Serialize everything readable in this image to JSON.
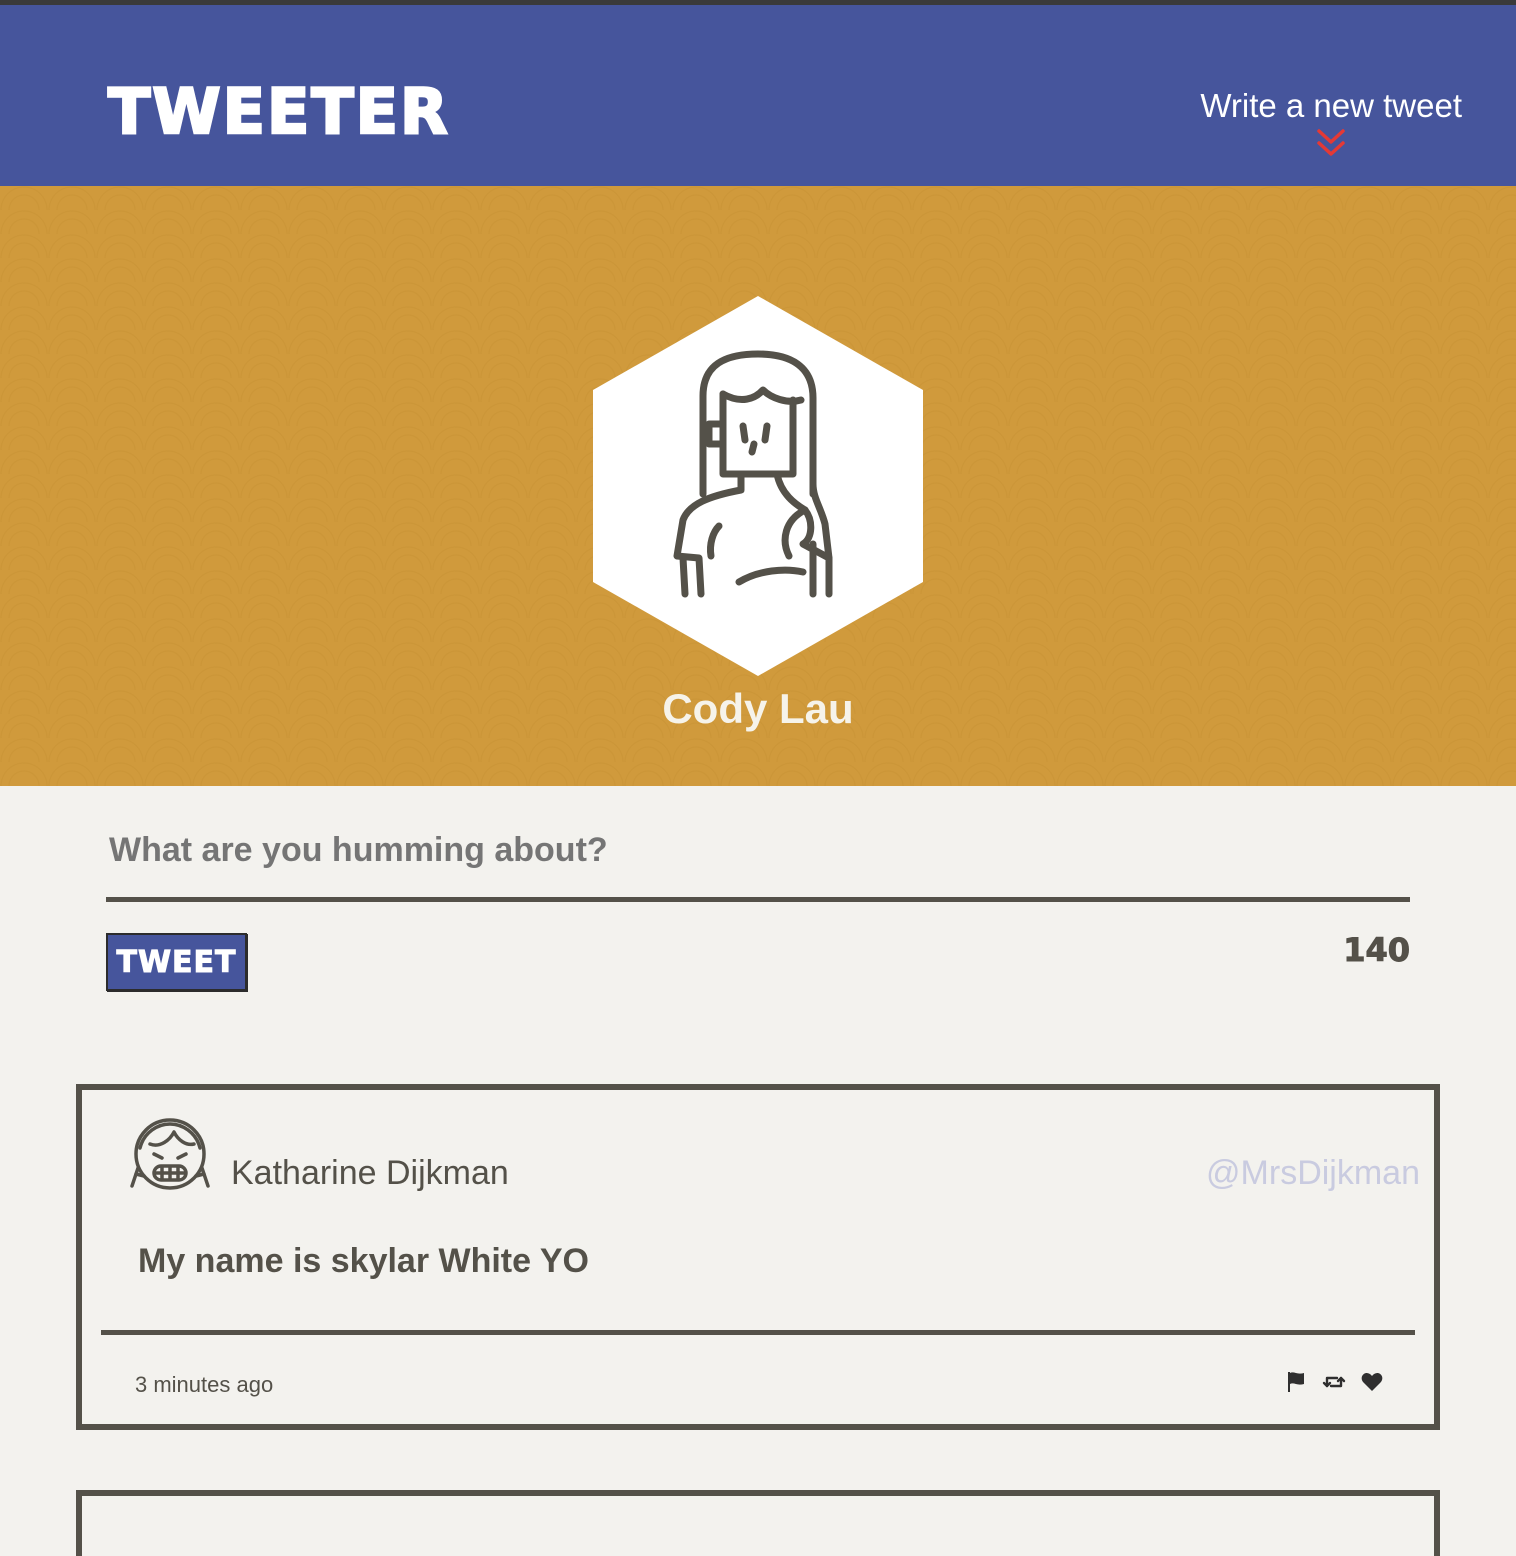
{
  "app": {
    "brand": "TWEETER",
    "nav_compose_label": "Write a new tweet"
  },
  "profile": {
    "name": "Cody Lau"
  },
  "composer": {
    "placeholder": "What are you humming about?",
    "button_label": "TWEET",
    "char_counter": "140"
  },
  "tweets": [
    {
      "author_name": "Katharine Dijkman",
      "handle": "@MrsDijkman",
      "text": "My name is skylar White YO",
      "time_ago": "3 minutes ago",
      "actions": [
        "flag-icon",
        "retweet-icon",
        "heart-icon"
      ]
    }
  ],
  "colors": {
    "nav_bg": "#46559c",
    "profile_bg": "#d09a3c",
    "page_bg": "#f3f2ee",
    "text": "#545149",
    "accent_red": "#e53935",
    "handle_color": "#c9cbe0"
  }
}
